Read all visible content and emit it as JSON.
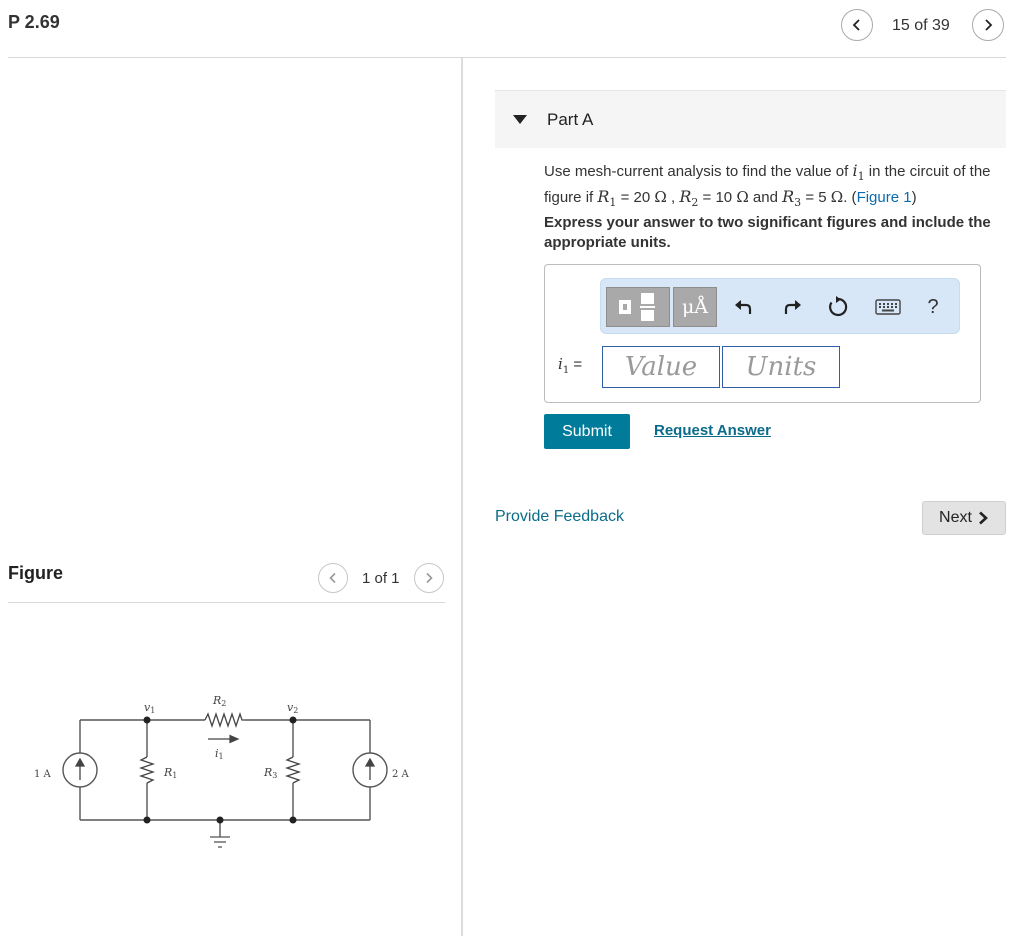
{
  "header": {
    "title": "P 2.69",
    "counter": "15 of 39"
  },
  "part": {
    "label": "Part A"
  },
  "question": {
    "text_before": "Use mesh-current analysis to find the value of ",
    "var_i1": "i",
    "sub_1": "1",
    "text_circuit": " in the circuit of the figure if ",
    "R1_var": "R",
    "R1_sub": "1",
    "R1_val": " = 20 ",
    "R2_var": "R",
    "R2_sub": "2",
    "R2_val": " = 10 ",
    "R3_var": "R",
    "R3_sub": "3",
    "R3_val": " = 5 ",
    "ohm": "Ω",
    "and": " and ",
    "comma": " , ",
    "figure_open": ". (",
    "figure_link": "Figure 1",
    "figure_close": ")"
  },
  "instructions": "Express your answer to two significant figures and include the appropriate units.",
  "answer": {
    "label_var": "i",
    "label_sub": "1",
    "label_eq": " =",
    "value_placeholder": "Value",
    "units_placeholder": "Units",
    "units_tool_label": "μÅ",
    "help_label": "?"
  },
  "actions": {
    "submit": "Submit",
    "request_answer": "Request Answer",
    "provide_feedback": "Provide Feedback",
    "next": "Next"
  },
  "figure": {
    "title": "Figure",
    "counter": "1 of 1",
    "labels": {
      "source_left": "1 A",
      "source_right": "2 A",
      "v1": "v",
      "v1_sub": "1",
      "v2": "v",
      "v2_sub": "2",
      "R1": "R",
      "R1_sub": "1",
      "R2": "R",
      "R2_sub": "2",
      "R3": "R",
      "R3_sub": "3",
      "i1": "i",
      "i1_sub": "1"
    }
  },
  "colors": {
    "accent": "#007c9a",
    "link": "#0b6b8b",
    "toolbar_bg": "#d7e7f8",
    "input_border": "#2e5fa8"
  }
}
